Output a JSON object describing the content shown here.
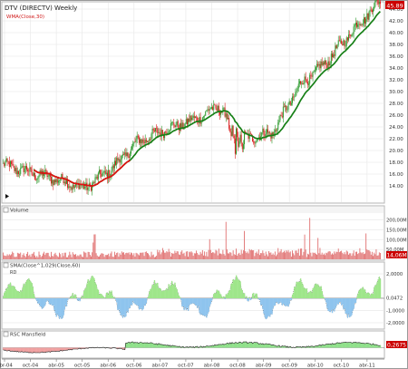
{
  "colors": {
    "up": "#2e9a2e",
    "down": "#d92020",
    "wma": "#178017",
    "red_line": "#e01010",
    "hist_pos": "#9ee68a",
    "hist_neg": "#8ec4ee",
    "rsc_pos": "#8fe08a",
    "rsc_neg": "#f0a0a0",
    "volume": "#e07070",
    "grid": "#e6e6e6",
    "badge": "#cc0000"
  },
  "chart_data": [
    {
      "type": "candlestick",
      "title": "DTV (DIRECTV) Weekly",
      "series_label": "WMA(Close,30)",
      "price_badge": "45.89",
      "y_ticks": [
        "44.00",
        "42.00",
        "40.00",
        "38.00",
        "36.00",
        "34.00",
        "32.00",
        "30.00",
        "28.00",
        "26.00",
        "24.00",
        "22.00",
        "20.00",
        "18.00",
        "16.00",
        "14.00"
      ],
      "x_labels": [
        "abr-04",
        "oct-04",
        "abr-05",
        "oct-05",
        "abr-06",
        "oct-06",
        "abr-07",
        "oct-07",
        "abr-08",
        "oct-08",
        "abr-09",
        "oct-09",
        "abr-10",
        "oct-10",
        "abr-11"
      ],
      "close_keypoints": [
        {
          "date": "abr-04",
          "close": 17.6
        },
        {
          "date": "oct-04",
          "close": 16.3
        },
        {
          "date": "abr-05",
          "close": 15.1
        },
        {
          "date": "oct-05",
          "close": 13.6
        },
        {
          "date": "abr-06",
          "close": 16.8
        },
        {
          "date": "oct-06",
          "close": 21.5
        },
        {
          "date": "abr-07",
          "close": 23.5
        },
        {
          "date": "oct-07",
          "close": 25.0
        },
        {
          "date": "abr-08",
          "close": 27.5
        },
        {
          "date": "oct-08",
          "close": 22.0
        },
        {
          "date": "abr-09",
          "close": 23.0
        },
        {
          "date": "oct-09",
          "close": 31.0
        },
        {
          "date": "abr-10",
          "close": 35.0
        },
        {
          "date": "oct-10",
          "close": 40.5
        },
        {
          "date": "abr-11",
          "close": 45.5
        }
      ]
    },
    {
      "type": "bar",
      "title": "Volume",
      "y_ticks": [
        "200,00M",
        "150,00M",
        "100,00M",
        "50,00M"
      ],
      "badge": "14,06M"
    },
    {
      "type": "area",
      "title": "SMA(Close^1,029(Close,60)",
      "subtitle": "RD",
      "y_ticks": [
        "2,0000",
        "0,0472",
        "-1,0000",
        "-2,0000"
      ],
      "badge": "0,0472"
    },
    {
      "type": "area",
      "title": "RSC Mansfield",
      "badge": "0,2675"
    }
  ]
}
